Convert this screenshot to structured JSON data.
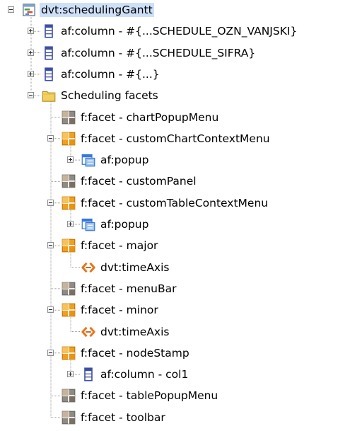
{
  "tree": {
    "nodes": [
      {
        "label": "dvt:schedulingGantt",
        "icon": "gantt-icon",
        "level": 0,
        "toggle": "expanded",
        "selected": true
      },
      {
        "label": "af:column - #{...SCHEDULE_OZN_VANJSKI}",
        "icon": "column-icon",
        "level": 1,
        "toggle": "collapsed"
      },
      {
        "label": "af:column - #{...SCHEDULE_SIFRA}",
        "icon": "column-icon",
        "level": 1,
        "toggle": "collapsed"
      },
      {
        "label": "af:column - #{...}",
        "icon": "column-icon",
        "level": 1,
        "toggle": "collapsed"
      },
      {
        "label": "Scheduling facets",
        "icon": "folder-icon",
        "level": 1,
        "toggle": "expanded"
      },
      {
        "label": "f:facet - chartPopupMenu",
        "icon": "facet-empty-icon",
        "level": 2,
        "toggle": "none"
      },
      {
        "label": "f:facet - customChartContextMenu",
        "icon": "facet-icon",
        "level": 2,
        "toggle": "expanded"
      },
      {
        "label": "af:popup",
        "icon": "popup-icon",
        "level": 3,
        "toggle": "collapsed"
      },
      {
        "label": "f:facet - customPanel",
        "icon": "facet-empty-icon",
        "level": 2,
        "toggle": "none"
      },
      {
        "label": "f:facet - customTableContextMenu",
        "icon": "facet-icon",
        "level": 2,
        "toggle": "expanded"
      },
      {
        "label": "af:popup",
        "icon": "popup-icon",
        "level": 3,
        "toggle": "collapsed"
      },
      {
        "label": "f:facet - major",
        "icon": "facet-icon",
        "level": 2,
        "toggle": "expanded"
      },
      {
        "label": "dvt:timeAxis",
        "icon": "time-axis-icon",
        "level": 3,
        "toggle": "none"
      },
      {
        "label": "f:facet - menuBar",
        "icon": "facet-empty-icon",
        "level": 2,
        "toggle": "none"
      },
      {
        "label": "f:facet - minor",
        "icon": "facet-icon",
        "level": 2,
        "toggle": "expanded"
      },
      {
        "label": "dvt:timeAxis",
        "icon": "time-axis-icon",
        "level": 3,
        "toggle": "none"
      },
      {
        "label": "f:facet - nodeStamp",
        "icon": "facet-icon",
        "level": 2,
        "toggle": "expanded"
      },
      {
        "label": "af:column - col1",
        "icon": "column-icon",
        "level": 3,
        "toggle": "collapsed"
      },
      {
        "label": "f:facet - tablePopupMenu",
        "icon": "facet-empty-icon",
        "level": 2,
        "toggle": "none"
      },
      {
        "label": "f:facet - toolbar",
        "icon": "facet-empty-icon",
        "level": 2,
        "toggle": "none"
      }
    ]
  },
  "colors": {
    "facet_orange": "#f0a020",
    "facet_grey": "#8e8a84",
    "folder_yellow": "#f2d060",
    "column_blue": "#3d4fa5",
    "popup_blue": "#3a78d8",
    "time_axis_orange": "#e8751a",
    "selection": "#cde0f7"
  }
}
